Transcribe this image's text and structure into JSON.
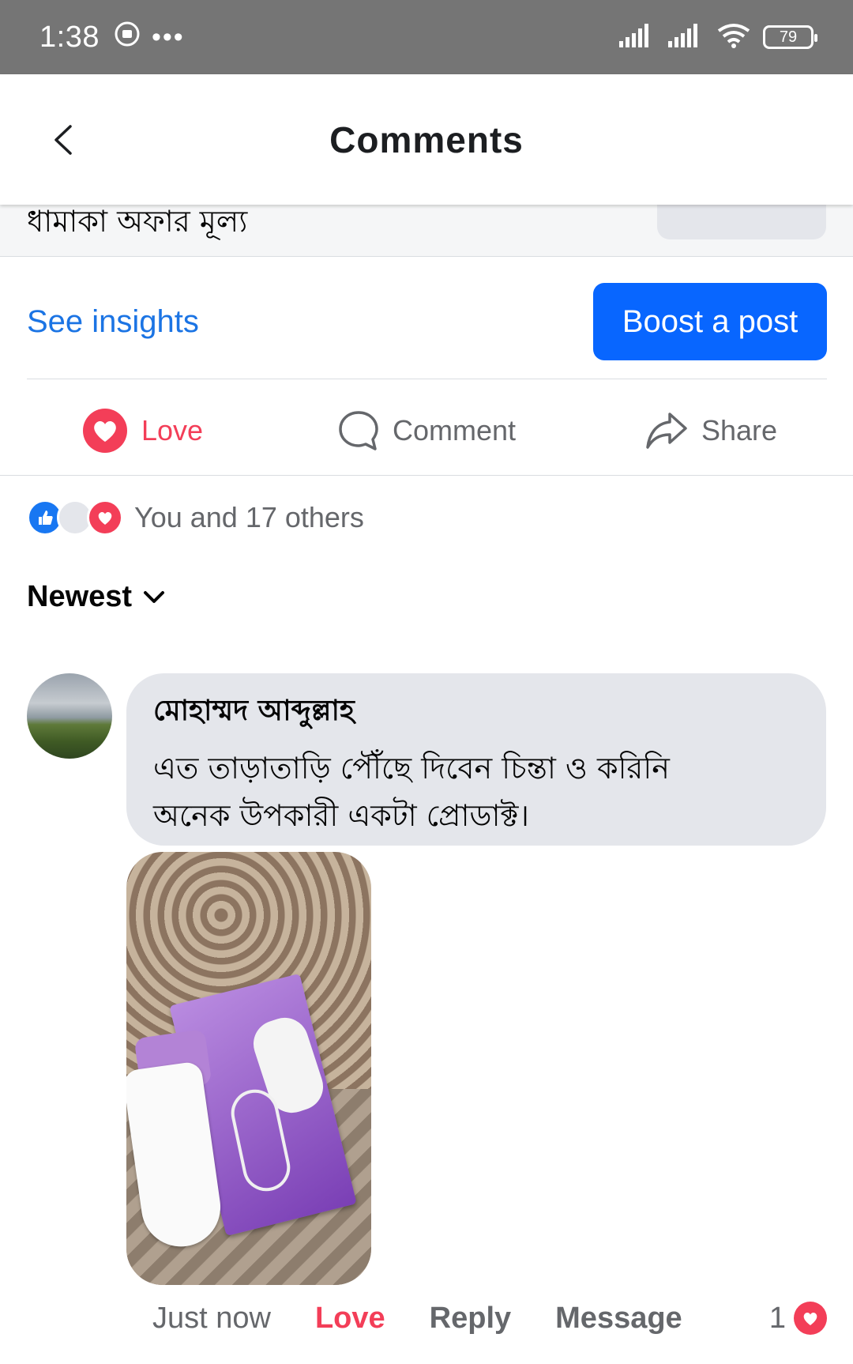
{
  "status_bar": {
    "time": "1:38",
    "dots": "•••",
    "battery": "79"
  },
  "header": {
    "title": "Comments"
  },
  "post_preview": {
    "promo_text": "ধামাকা অফার মূল্য"
  },
  "insights": {
    "see_insights": "See insights",
    "boost_label": "Boost a post"
  },
  "actions": {
    "love": "Love",
    "comment": "Comment",
    "share": "Share"
  },
  "reactions": {
    "summary": "You and 17 others",
    "icons": [
      "like-icon",
      "neutral-icon",
      "love-icon"
    ]
  },
  "sort": {
    "label": "Newest"
  },
  "comment": {
    "author": "মোহাম্মদ আব্দুল্লাহ",
    "line1": "এত তাড়াতাড়ি পৌঁছে দিবেন চিন্তা ও করিনি",
    "line2": "অনেক উপকারী একটা প্রোডাক্ট।",
    "time": "Just now",
    "love": "Love",
    "reply": "Reply",
    "message": "Message",
    "reaction_count": "1"
  },
  "colors": {
    "brand_blue": "#0866ff",
    "link_blue": "#1b74e4",
    "love_red": "#f33e58",
    "status_bar": "#757575"
  }
}
